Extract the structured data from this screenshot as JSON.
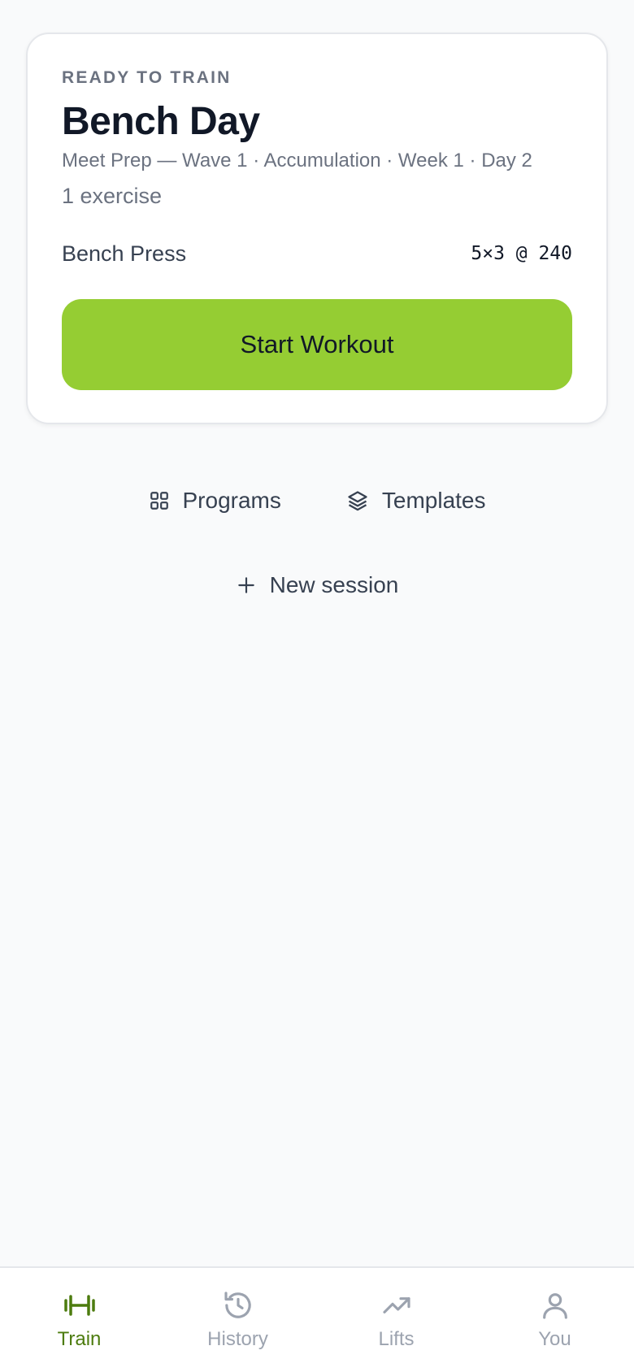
{
  "card": {
    "eyebrow": "READY TO TRAIN",
    "title": "Bench Day",
    "subtitle": "Meet Prep — Wave 1 · Accumulation · Week 1 · Day 2",
    "exercise_count": "1 exercise",
    "exercises": [
      {
        "name": "Bench Press",
        "scheme": "5×3 @ 240"
      }
    ],
    "start_label": "Start Workout",
    "accent_color": "#95cd33"
  },
  "links": {
    "programs_label": "Programs",
    "programs_icon": "grid-icon",
    "templates_label": "Templates",
    "templates_icon": "layers-icon",
    "new_session_label": "New session",
    "new_session_icon": "plus-icon"
  },
  "tabbar": {
    "active_color": "#4d7c0f",
    "inactive_color": "#9ca3af",
    "items": [
      {
        "label": "Train",
        "icon": "dumbbell-icon",
        "active": true
      },
      {
        "label": "History",
        "icon": "history-icon",
        "active": false
      },
      {
        "label": "Lifts",
        "icon": "trending-up-icon",
        "active": false
      },
      {
        "label": "You",
        "icon": "user-icon",
        "active": false
      }
    ]
  }
}
